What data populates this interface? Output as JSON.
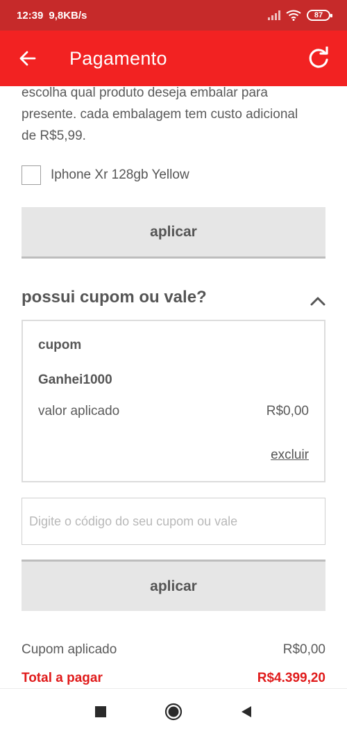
{
  "status_bar": {
    "time": "12:39",
    "speed": "9,8KB/s",
    "battery": "87"
  },
  "app_bar": {
    "title": "Pagamento",
    "back_icon": "arrow-left-icon",
    "refresh_icon": "refresh-icon"
  },
  "gift": {
    "description": "escolha qual produto deseja embalar para presente. cada embalagem tem custo adicional de R$5,99.",
    "option_label": "Iphone Xr 128gb Yellow",
    "checked": false,
    "apply_label": "aplicar"
  },
  "coupon": {
    "section_title": "possui cupom ou vale?",
    "card_label": "cupom",
    "code": "Ganhei1000",
    "applied_label": "valor aplicado",
    "applied_value": "R$0,00",
    "remove_label": "excluir",
    "input_placeholder": "Digite o código do seu cupom ou vale",
    "input_value": "",
    "apply_label": "aplicar"
  },
  "summary": {
    "coupon_applied_label": "Cupom aplicado",
    "coupon_applied_value": "R$0,00",
    "total_label": "Total a pagar",
    "total_value": "R$4.399,20"
  },
  "colors": {
    "status_bar": "#c62a2a",
    "app_bar": "#f22222",
    "total": "#e01b1b",
    "button": "#e6e6e6"
  }
}
